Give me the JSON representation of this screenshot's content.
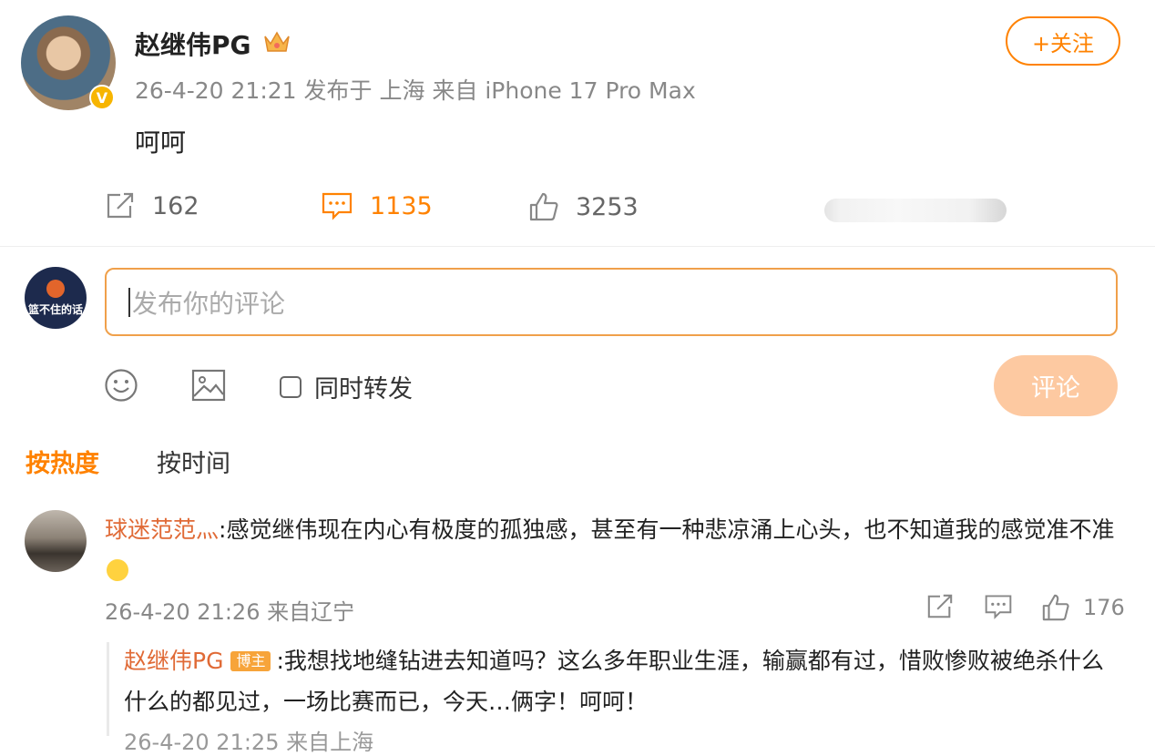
{
  "post": {
    "username": "赵继伟PG",
    "verified_badge": "V",
    "crown_icon": "crown-icon",
    "meta": "26-4-20 21:21 发布于 上海 来自 iPhone 17 Pro Max",
    "content": "呵呵",
    "follow_label": "+关注",
    "reposts": "162",
    "comments": "1135",
    "likes": "3253"
  },
  "composer": {
    "avatar_label": "篮不住的话",
    "placeholder": "发布你的评论",
    "repost_label": "同时转发",
    "submit_label": "评论"
  },
  "sort": {
    "hot": "按热度",
    "time": "按时间"
  },
  "comments": [
    {
      "user": "球迷范范灬",
      "text": ":感觉继伟现在内心有极度的孤独感，甚至有一种悲凉涌上心头，也不知道我的感觉准不准",
      "meta": "26-4-20 21:26 来自辽宁",
      "likes": "176",
      "reply": {
        "user": "赵继伟PG",
        "tag": "博主",
        "text": ":我想找地缝钻进去知道吗？这么多年职业生涯，输赢都有过，惜败惨败被绝杀什么什么的都见过，一场比赛而已，今天…俩字！呵呵！",
        "meta": "26-4-20 21:25 来自上海"
      }
    }
  ],
  "colors": {
    "accent": "#ff8200",
    "username_link": "#e06a36",
    "submit_disabled": "#fdc9a1"
  }
}
